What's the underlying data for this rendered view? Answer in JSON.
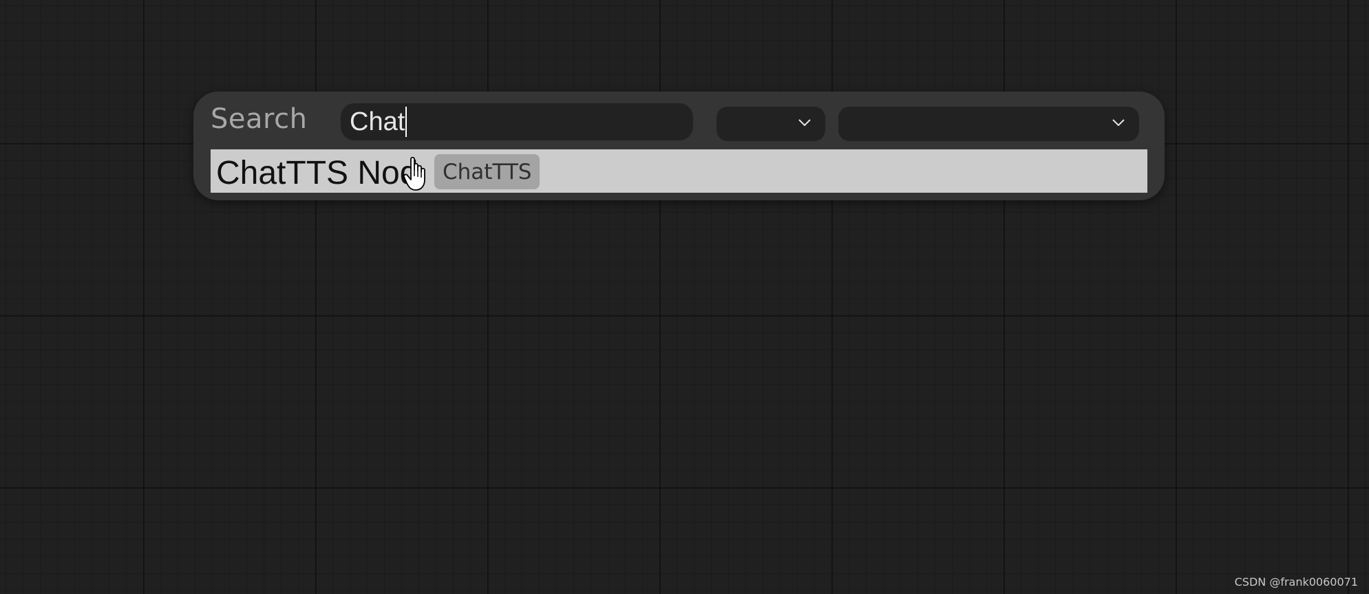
{
  "search": {
    "label": "Search",
    "value": "Chat"
  },
  "filters": [
    {
      "selected": ""
    },
    {
      "selected": ""
    }
  ],
  "results": [
    {
      "name": "ChatTTS Nod",
      "tag": "ChatTTS"
    }
  ],
  "icons": {
    "dropdown": "chevron-down-icon",
    "cursor": "hand-pointer-cursor-icon"
  },
  "colors": {
    "canvas": "#202020",
    "dialog": "#353535",
    "input": "#222222",
    "result_highlight": "#cccccc",
    "tag": "#a4a4a4"
  },
  "watermark": "CSDN @frank0060071"
}
